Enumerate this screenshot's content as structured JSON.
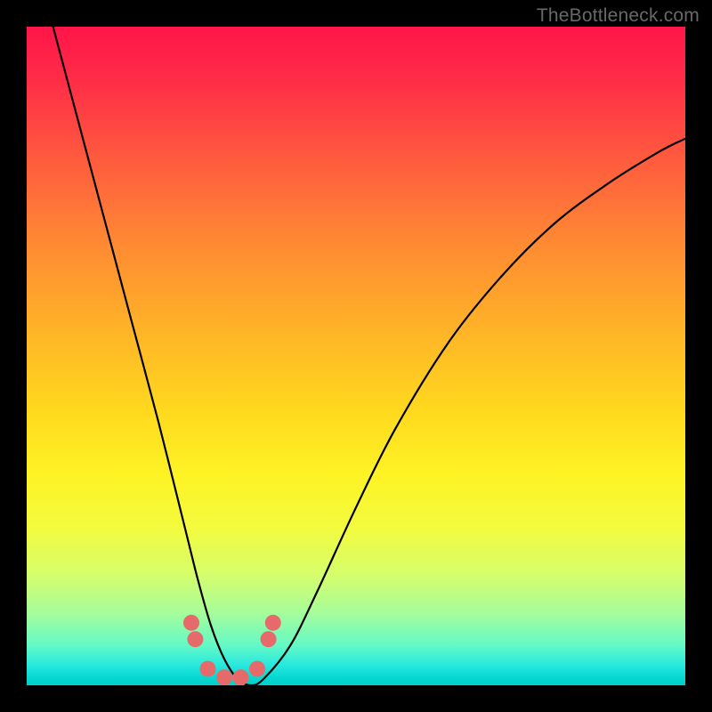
{
  "watermark": "TheBottleneck.com",
  "gradient_colors": {
    "top": "#ff1549",
    "upper_mid": "#ff8a33",
    "mid": "#ffd81e",
    "lower_mid": "#d7fd6a",
    "bottom": "#00d0c9"
  },
  "chart_data": {
    "type": "line",
    "title": "",
    "xlabel": "",
    "ylabel": "",
    "xlim": [
      0,
      100
    ],
    "ylim": [
      0,
      100
    ],
    "series": [
      {
        "name": "bottleneck-curve",
        "x": [
          4,
          8,
          12,
          16,
          20,
          24,
          26,
          28,
          30,
          32,
          34,
          36,
          40,
          44,
          50,
          56,
          64,
          72,
          80,
          88,
          96,
          100
        ],
        "y": [
          100,
          85,
          70,
          55,
          40,
          24,
          16,
          9,
          4,
          1,
          0,
          1,
          6,
          14,
          27,
          39,
          52,
          62,
          70,
          76,
          81,
          83
        ]
      },
      {
        "name": "marker-dots",
        "x": [
          25.0,
          25.6,
          27.5,
          30.0,
          32.5,
          35.0,
          36.7,
          37.4
        ],
        "y": [
          9.5,
          7.0,
          2.5,
          1.2,
          1.2,
          2.5,
          7.0,
          9.5
        ]
      }
    ],
    "marker_color": "#e66a6a",
    "curve_color": "#000000"
  }
}
